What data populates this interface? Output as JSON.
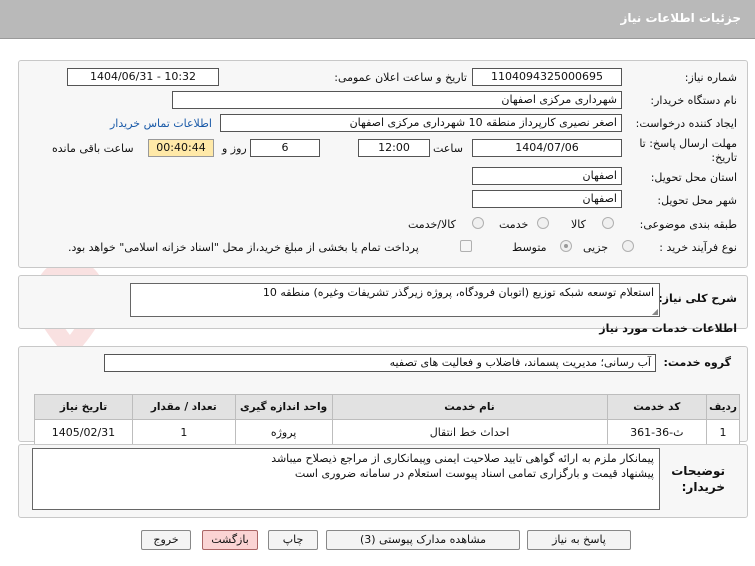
{
  "header": {
    "title": "جزئیات اطلاعات نیاز"
  },
  "form": {
    "need_number_label": "شماره نیاز:",
    "need_number": "1104094325000695",
    "announce_label": "تاریخ و ساعت اعلان عمومی:",
    "announce_value": "1404/06/31 - 10:32",
    "buyer_org_label": "نام دستگاه خریدار:",
    "buyer_org": "شهرداری مرکزی اصفهان",
    "requester_label": "ایجاد کننده درخواست:",
    "requester": "اصغر نصیری کارپرداز منطقه 10 شهرداری مرکزی اصفهان",
    "contact_link": "اطلاعات تماس خریدار",
    "deadline_label_1": "مهلت ارسال پاسخ: تا",
    "deadline_label_2": "تاریخ:",
    "deadline_date": "1404/07/06",
    "time_label": "ساعت",
    "deadline_time": "12:00",
    "days_value": "6",
    "days_label": "روز و",
    "remaining_value": "00:40:44",
    "remaining_label": "ساعت باقی مانده",
    "province_label": "استان محل تحویل:",
    "province": "اصفهان",
    "city_label": "شهر محل تحویل:",
    "city": "اصفهان",
    "category_label": "طبقه بندی موضوعی:",
    "category_options": [
      "کالا",
      "خدمت",
      "کالا/خدمت"
    ],
    "process_label": "نوع فرآیند خرید :",
    "process_options": [
      "جزیی",
      "متوسط"
    ],
    "payment_note": "پرداخت تمام یا بخشی از مبلغ خرید،از محل \"اسناد خزانه اسلامی\" خواهد بود."
  },
  "summary": {
    "label": "شرح کلی نیاز:",
    "value": "استعلام توسعه شبکه توزیع  (اتوبان فرودگاه، پروژه زیرگذر تشریفات وغیره) منطقه 10"
  },
  "services": {
    "section_title": "اطلاعات خدمات مورد نیاز",
    "group_label": "گروه خدمت:",
    "group_value": "آب رسانی؛ مدیریت پسماند، فاضلاب و فعالیت های تصفیه",
    "columns": [
      "ردیف",
      "کد خدمت",
      "نام خدمت",
      "واحد اندازه گیری",
      "تعداد / مقدار",
      "تاریخ نیاز"
    ],
    "rows": [
      {
        "row": "1",
        "code": "ث-36-361",
        "name": "احداث خط انتقال",
        "unit": "پروژه",
        "qty": "1",
        "date": "1405/02/31"
      }
    ]
  },
  "notes": {
    "label_1": "توضیحات",
    "label_2": "خریدار:",
    "line_1": "پیمانکار ملزم به ارائه گواهی تایید صلاحیت ایمنی وپیمانکاری از مراجع ذیصلاح میباشد",
    "line_2": "پیشنهاد قیمت و بارگزاری تمامی اسناد پیوست استعلام در سامانه ضروری است"
  },
  "buttons": {
    "reply": "پاسخ به نیاز",
    "attachments": "مشاهده مدارک پیوستی (3)",
    "print": "چاپ",
    "back": "بازگشت",
    "exit": "خروج"
  },
  "watermark": "AriaTender.net",
  "colors": {
    "header": "#b9b9b9",
    "remaining_bg": "#ffe9a8",
    "link": "#1a5aa8",
    "back_button": "#fbd4d4"
  }
}
